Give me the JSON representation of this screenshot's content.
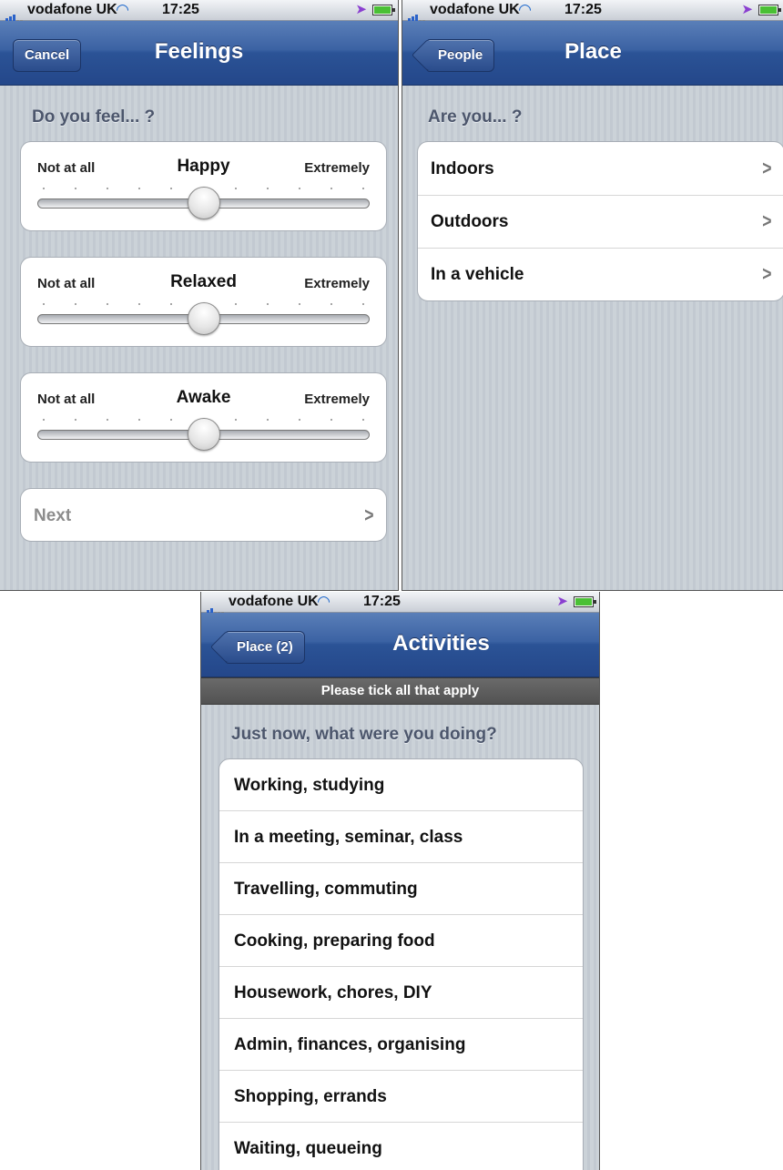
{
  "status": {
    "carrier": "vodafone UK",
    "time": "17:25"
  },
  "feelings": {
    "title": "Feelings",
    "cancel_label": "Cancel",
    "question": "Do you feel... ?",
    "sliders": [
      {
        "label": "Happy",
        "left": "Not at all",
        "right": "Extremely",
        "value": 0.5
      },
      {
        "label": "Relaxed",
        "left": "Not at all",
        "right": "Extremely",
        "value": 0.5
      },
      {
        "label": "Awake",
        "left": "Not at all",
        "right": "Extremely",
        "value": 0.5
      }
    ],
    "next_label": "Next",
    "chevron": ">"
  },
  "place": {
    "title": "Place",
    "back_label": "People",
    "question": "Are you... ?",
    "options": [
      "Indoors",
      "Outdoors",
      "In a vehicle"
    ],
    "chevron": ">"
  },
  "activities": {
    "title": "Activities",
    "back_label": "Place (2)",
    "banner": "Please tick all that apply",
    "question": "Just now, what were you doing?",
    "options": [
      "Working, studying",
      "In a meeting, seminar, class",
      "Travelling, commuting",
      "Cooking, preparing food",
      "Housework, chores, DIY",
      "Admin, finances, organising",
      "Shopping, errands",
      "Waiting, queueing"
    ]
  },
  "icons": {
    "signal": "signal-bars-icon",
    "wifi": "wifi-icon",
    "location": "location-arrow-icon",
    "battery": "battery-icon"
  },
  "colors": {
    "navbar": "#2b5396",
    "background": "#c5ccd4",
    "banner": "#5e5e5e"
  }
}
